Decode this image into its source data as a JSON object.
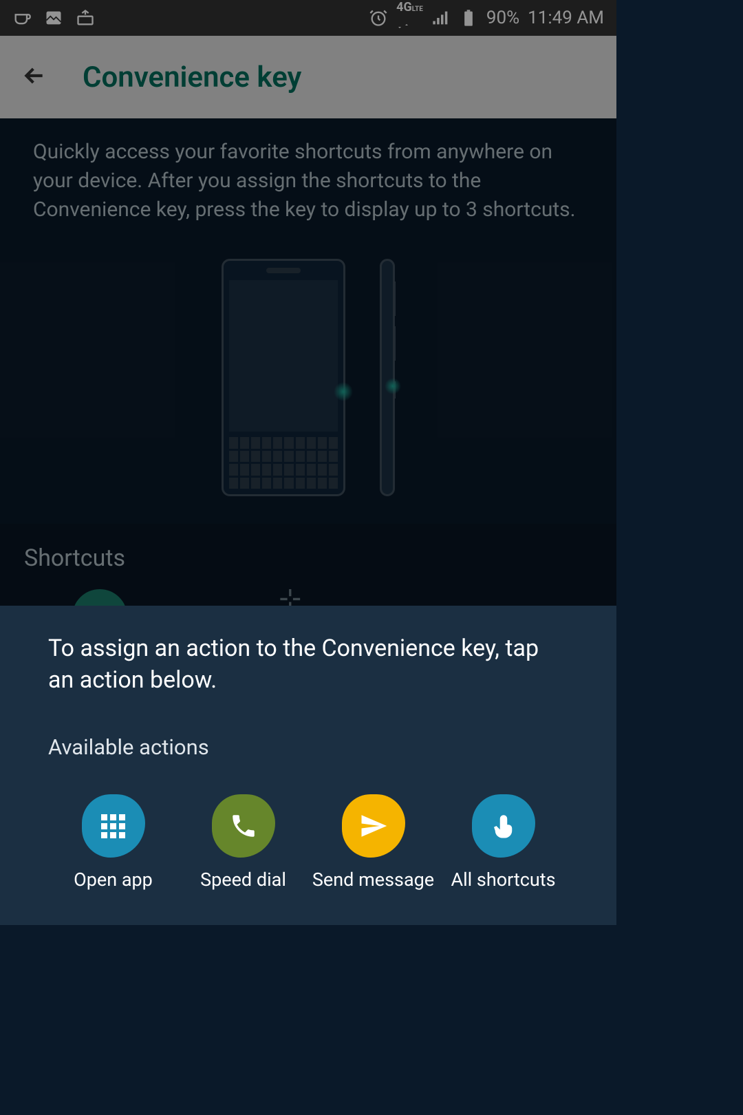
{
  "statusBar": {
    "network": "4G",
    "networkSub": "LTE",
    "battery": "90%",
    "time": "11:49 AM"
  },
  "appBar": {
    "title": "Convenience key"
  },
  "main": {
    "description": "Quickly access your favorite shortcuts from anywhere on your device. After you assign the shortcuts to the Convenience key, press the key to display up to 3 shortcuts."
  },
  "shortcuts": {
    "title": "Shortcuts"
  },
  "bottomSheet": {
    "title": "To assign an action to the Convenience key, tap an action below.",
    "subtitle": "Available actions",
    "actions": [
      {
        "label": "Open app",
        "icon": "grid-icon",
        "color": "blue"
      },
      {
        "label": "Speed dial",
        "icon": "phone-icon",
        "color": "green"
      },
      {
        "label": "Send message",
        "icon": "send-icon",
        "color": "yellow"
      },
      {
        "label": "All shortcuts",
        "icon": "tap-icon",
        "color": "blue2"
      }
    ]
  }
}
